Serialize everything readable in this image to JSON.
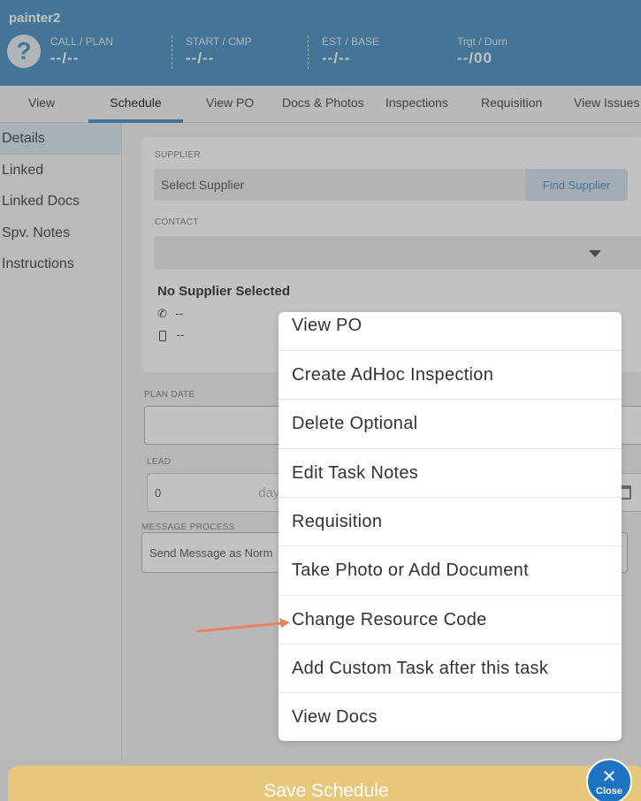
{
  "header": {
    "title": "painter2",
    "help_icon": "question-circle-icon",
    "stats": [
      {
        "label": "CALL / PLAN",
        "value": "--/--"
      },
      {
        "label": "START / CMP",
        "value": "--/--"
      },
      {
        "label": "EST / BASE",
        "value": "--/--"
      },
      {
        "label": "Trgt / Durn",
        "value": "--/00"
      }
    ]
  },
  "tabs": [
    {
      "label": "View"
    },
    {
      "label": "Schedule"
    },
    {
      "label": "View PO"
    },
    {
      "label": "Docs & Photos"
    },
    {
      "label": "Inspections"
    },
    {
      "label": "Requisition"
    },
    {
      "label": "View Issues"
    }
  ],
  "sidebar": {
    "items": [
      {
        "label": "Details"
      },
      {
        "label": "Linked"
      },
      {
        "label": "Linked Docs"
      },
      {
        "label": "Spv. Notes"
      },
      {
        "label": "Instructions"
      }
    ]
  },
  "form": {
    "supplier_label": "SUPPLIER",
    "supplier_value": "Select Supplier",
    "find_supplier": "Find Supplier",
    "contact_label": "CONTACT",
    "no_supplier": "No Supplier Selected",
    "phone": "--",
    "mobile": "--",
    "plan_date_label": "PLAN DATE",
    "lead_label": "LEAD",
    "lead_value": "0",
    "lead_unit": "day",
    "message_label": "MESSAGE PROCESS",
    "message_value": "Send Message as Norm"
  },
  "menu": {
    "items": [
      {
        "label": "View PO"
      },
      {
        "label": "Create AdHoc Inspection"
      },
      {
        "label": "Delete Optional"
      },
      {
        "label": "Edit Task Notes"
      },
      {
        "label": "Requisition"
      },
      {
        "label": "Take Photo or Add Document"
      },
      {
        "label": "Change Resource Code"
      },
      {
        "label": "Add Custom Task after this task"
      },
      {
        "label": "View Docs"
      }
    ]
  },
  "footer": {
    "save_label": "Save Schedule",
    "close_label": "Close"
  },
  "colors": {
    "header_bg": "#5b9ac6",
    "save_bg": "#e7c77c",
    "close_bg": "#1d72c2",
    "arrow": "#e8825c"
  }
}
